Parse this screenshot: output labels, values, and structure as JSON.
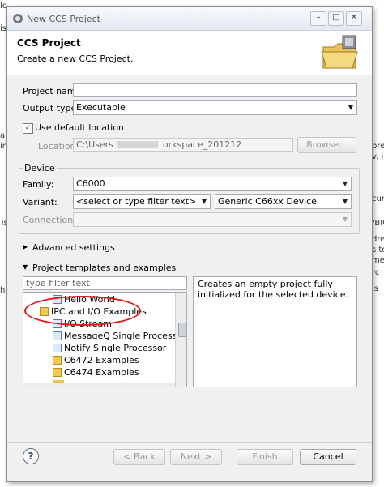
{
  "background": {
    "left_text": [
      "lo",
      "is",
      "a gu",
      "in ti",
      "Ts",
      "hd"
    ],
    "right_text": [
      "prev",
      "v. i",
      "cum",
      "/BIC",
      "dre",
      "s to",
      "met",
      "rc",
      "is"
    ]
  },
  "window": {
    "title": "New CCS Project",
    "minimize": "–",
    "maximize": "□",
    "close": "✕"
  },
  "header": {
    "title": "CCS Project",
    "subtitle": "Create a new CCS Project."
  },
  "form": {
    "project_name_label": "Project name:",
    "project_name_value": "",
    "output_type_label": "Output type:",
    "output_type_value": "Executable",
    "use_default_location_label": "Use default location",
    "location_label": "Location:",
    "location_value_prefix": "C:\\Users",
    "location_value_suffix": "orkspace_201212",
    "browse_label": "Browse..."
  },
  "device": {
    "group_label": "Device",
    "family_label": "Family:",
    "family_value": "C6000",
    "variant_label": "Variant:",
    "variant_filter_value": "<select or type filter text>",
    "variant_value": "Generic C66xx Device",
    "connection_label": "Connection:",
    "connection_value": ""
  },
  "sections": {
    "advanced_settings": "Advanced settings",
    "templates": "Project templates and examples"
  },
  "templates": {
    "filter_placeholder": "type filter text",
    "items": [
      {
        "label": "Hello World",
        "icon": "doc"
      },
      {
        "label": "IPC and I/O Examples",
        "icon": "folder"
      },
      {
        "label": "I/O Stream",
        "icon": "doc"
      },
      {
        "label": "MessageQ Single Processor",
        "icon": "doc"
      },
      {
        "label": "Notify Single Processor",
        "icon": "doc"
      },
      {
        "label": "C6472 Examples",
        "icon": "folder"
      },
      {
        "label": "C6474 Examples",
        "icon": "folder"
      }
    ],
    "description": "Creates an empty project fully initialized for the selected device."
  },
  "footer": {
    "help": "?",
    "back": "< Back",
    "next": "Next >",
    "finish": "Finish",
    "cancel": "Cancel"
  },
  "colors": {
    "highlight_oval": "#e01818",
    "dialog_bg": "#f0f0f0"
  }
}
